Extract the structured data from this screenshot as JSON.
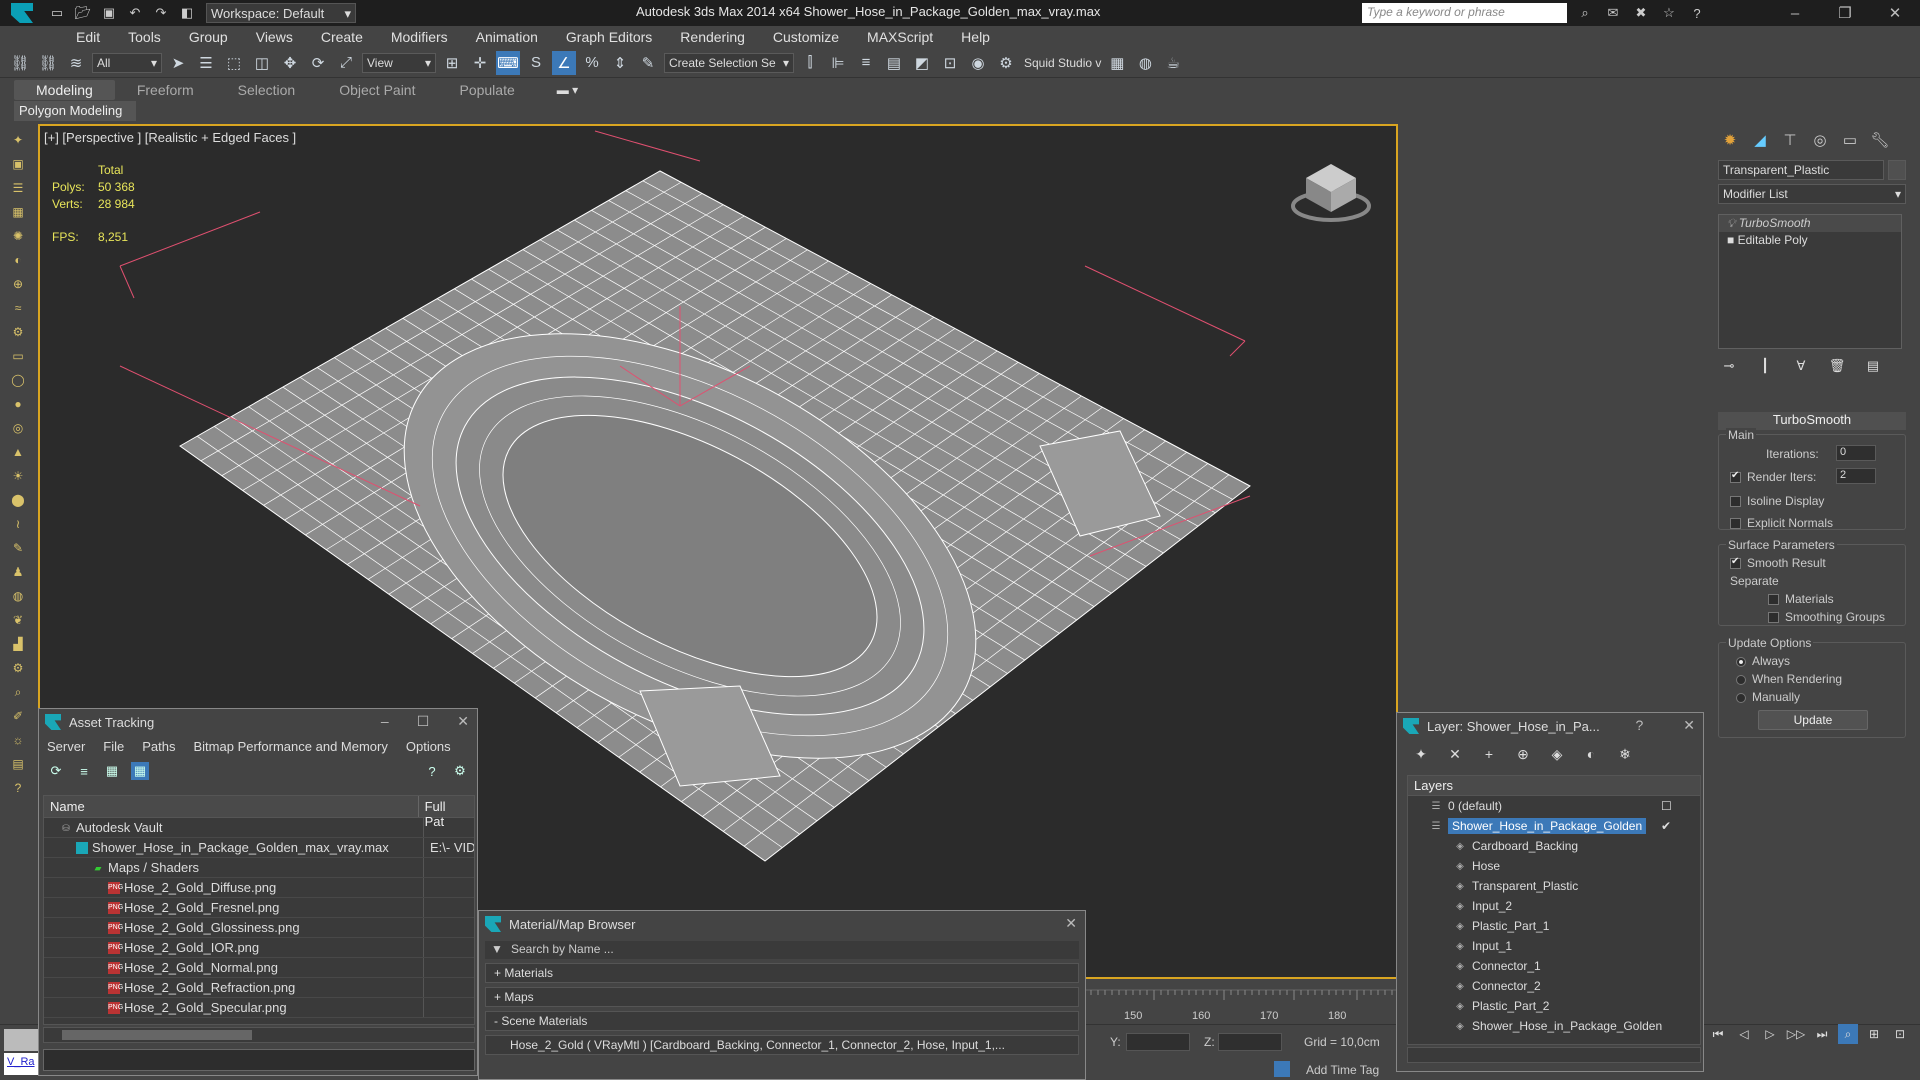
{
  "titlebar": {
    "workspace": "Workspace: Default",
    "title": "Autodesk 3ds Max  2014 x64     Shower_Hose_in_Package_Golden_max_vray.max",
    "search_placeholder": "Type a keyword or phrase"
  },
  "menu": [
    "Edit",
    "Tools",
    "Group",
    "Views",
    "Create",
    "Modifiers",
    "Animation",
    "Graph Editors",
    "Rendering",
    "Customize",
    "MAXScript",
    "Help"
  ],
  "toolbar": {
    "filter": "All",
    "refcoord": "View",
    "selection_set": "Create Selection Se",
    "squid": "Squid Studio v"
  },
  "ribbon": {
    "tabs": [
      "Modeling",
      "Freeform",
      "Selection",
      "Object Paint",
      "Populate"
    ],
    "panel": "Polygon Modeling"
  },
  "viewport": {
    "label": "[+] [Perspective ] [Realistic + Edged Faces ]",
    "stats_header": "Total",
    "polys_label": "Polys:",
    "polys": "50 368",
    "verts_label": "Verts:",
    "verts": "28 984",
    "fps_label": "FPS:",
    "fps": "8,251"
  },
  "command_panel": {
    "object_name": "Transparent_Plastic",
    "modifier_list": "Modifier List",
    "stack": [
      "TurboSmooth",
      "Editable Poly"
    ],
    "rollout_title": "TurboSmooth",
    "main_label": "Main",
    "iterations_label": "Iterations:",
    "iterations": "0",
    "render_iters_label": "Render Iters:",
    "render_iters": "2",
    "isoline": "Isoline Display",
    "explicit_normals": "Explicit Normals",
    "surface_params": "Surface Parameters",
    "smooth_result": "Smooth Result",
    "separate": "Separate",
    "materials": "Materials",
    "smoothing_groups": "Smoothing Groups",
    "update_options": "Update Options",
    "always": "Always",
    "when_rendering": "When Rendering",
    "manually": "Manually",
    "update_btn": "Update"
  },
  "asset_tracking": {
    "title": "Asset Tracking",
    "menu": [
      "Server",
      "File",
      "Paths",
      "Bitmap Performance and Memory",
      "Options"
    ],
    "col_name": "Name",
    "col_path": "Full Pat",
    "rows": [
      {
        "name": "Autodesk Vault",
        "path": "",
        "indent": 1,
        "icon": "vault"
      },
      {
        "name": "Shower_Hose_in_Package_Golden_max_vray.max",
        "path": "E:\\- VID",
        "indent": 2,
        "icon": "max"
      },
      {
        "name": "Maps / Shaders",
        "path": "",
        "indent": 3,
        "icon": "maps"
      },
      {
        "name": "Hose_2_Gold_Diffuse.png",
        "path": "",
        "indent": 4,
        "icon": "png"
      },
      {
        "name": "Hose_2_Gold_Fresnel.png",
        "path": "",
        "indent": 4,
        "icon": "png"
      },
      {
        "name": "Hose_2_Gold_Glossiness.png",
        "path": "",
        "indent": 4,
        "icon": "png"
      },
      {
        "name": "Hose_2_Gold_IOR.png",
        "path": "",
        "indent": 4,
        "icon": "png"
      },
      {
        "name": "Hose_2_Gold_Normal.png",
        "path": "",
        "indent": 4,
        "icon": "png"
      },
      {
        "name": "Hose_2_Gold_Refraction.png",
        "path": "",
        "indent": 4,
        "icon": "png"
      },
      {
        "name": "Hose_2_Gold_Specular.png",
        "path": "",
        "indent": 4,
        "icon": "png"
      }
    ]
  },
  "material_browser": {
    "title": "Material/Map Browser",
    "search": "Search by Name ...",
    "sections": [
      "+ Materials",
      "+ Maps",
      "- Scene Materials"
    ],
    "item": "Hose_2_Gold ( VRayMtl ) [Cardboard_Backing, Connector_1, Connector_2, Hose, Input_1,..."
  },
  "layer_window": {
    "title": "Layer: Shower_Hose_in_Pa...",
    "header": "Layers",
    "rows": [
      {
        "name": "0 (default)",
        "level": 0,
        "selected": false
      },
      {
        "name": "Shower_Hose_in_Package_Golden",
        "level": 0,
        "selected": true
      },
      {
        "name": "Cardboard_Backing",
        "level": 1,
        "selected": false
      },
      {
        "name": "Hose",
        "level": 1,
        "selected": false
      },
      {
        "name": "Transparent_Plastic",
        "level": 1,
        "selected": false
      },
      {
        "name": "Input_2",
        "level": 1,
        "selected": false
      },
      {
        "name": "Plastic_Part_1",
        "level": 1,
        "selected": false
      },
      {
        "name": "Input_1",
        "level": 1,
        "selected": false
      },
      {
        "name": "Connector_1",
        "level": 1,
        "selected": false
      },
      {
        "name": "Connector_2",
        "level": 1,
        "selected": false
      },
      {
        "name": "Plastic_Part_2",
        "level": 1,
        "selected": false
      },
      {
        "name": "Shower_Hose_in_Package_Golden",
        "level": 1,
        "selected": false
      }
    ]
  },
  "timeline": {
    "ticks": [
      "150",
      "160",
      "170",
      "180"
    ]
  },
  "status": {
    "y_label": "Y:",
    "z_label": "Z:",
    "grid": "Grid = 10,0cm",
    "add_time_tag": "Add Time Tag",
    "script_label": "V_Ra"
  },
  "colors": {
    "accent": "#3c79b8",
    "viewport_border": "#d9a521",
    "stats": "#e8e55a",
    "wire": "#ffffff",
    "mesh": "#8a8a8a"
  }
}
